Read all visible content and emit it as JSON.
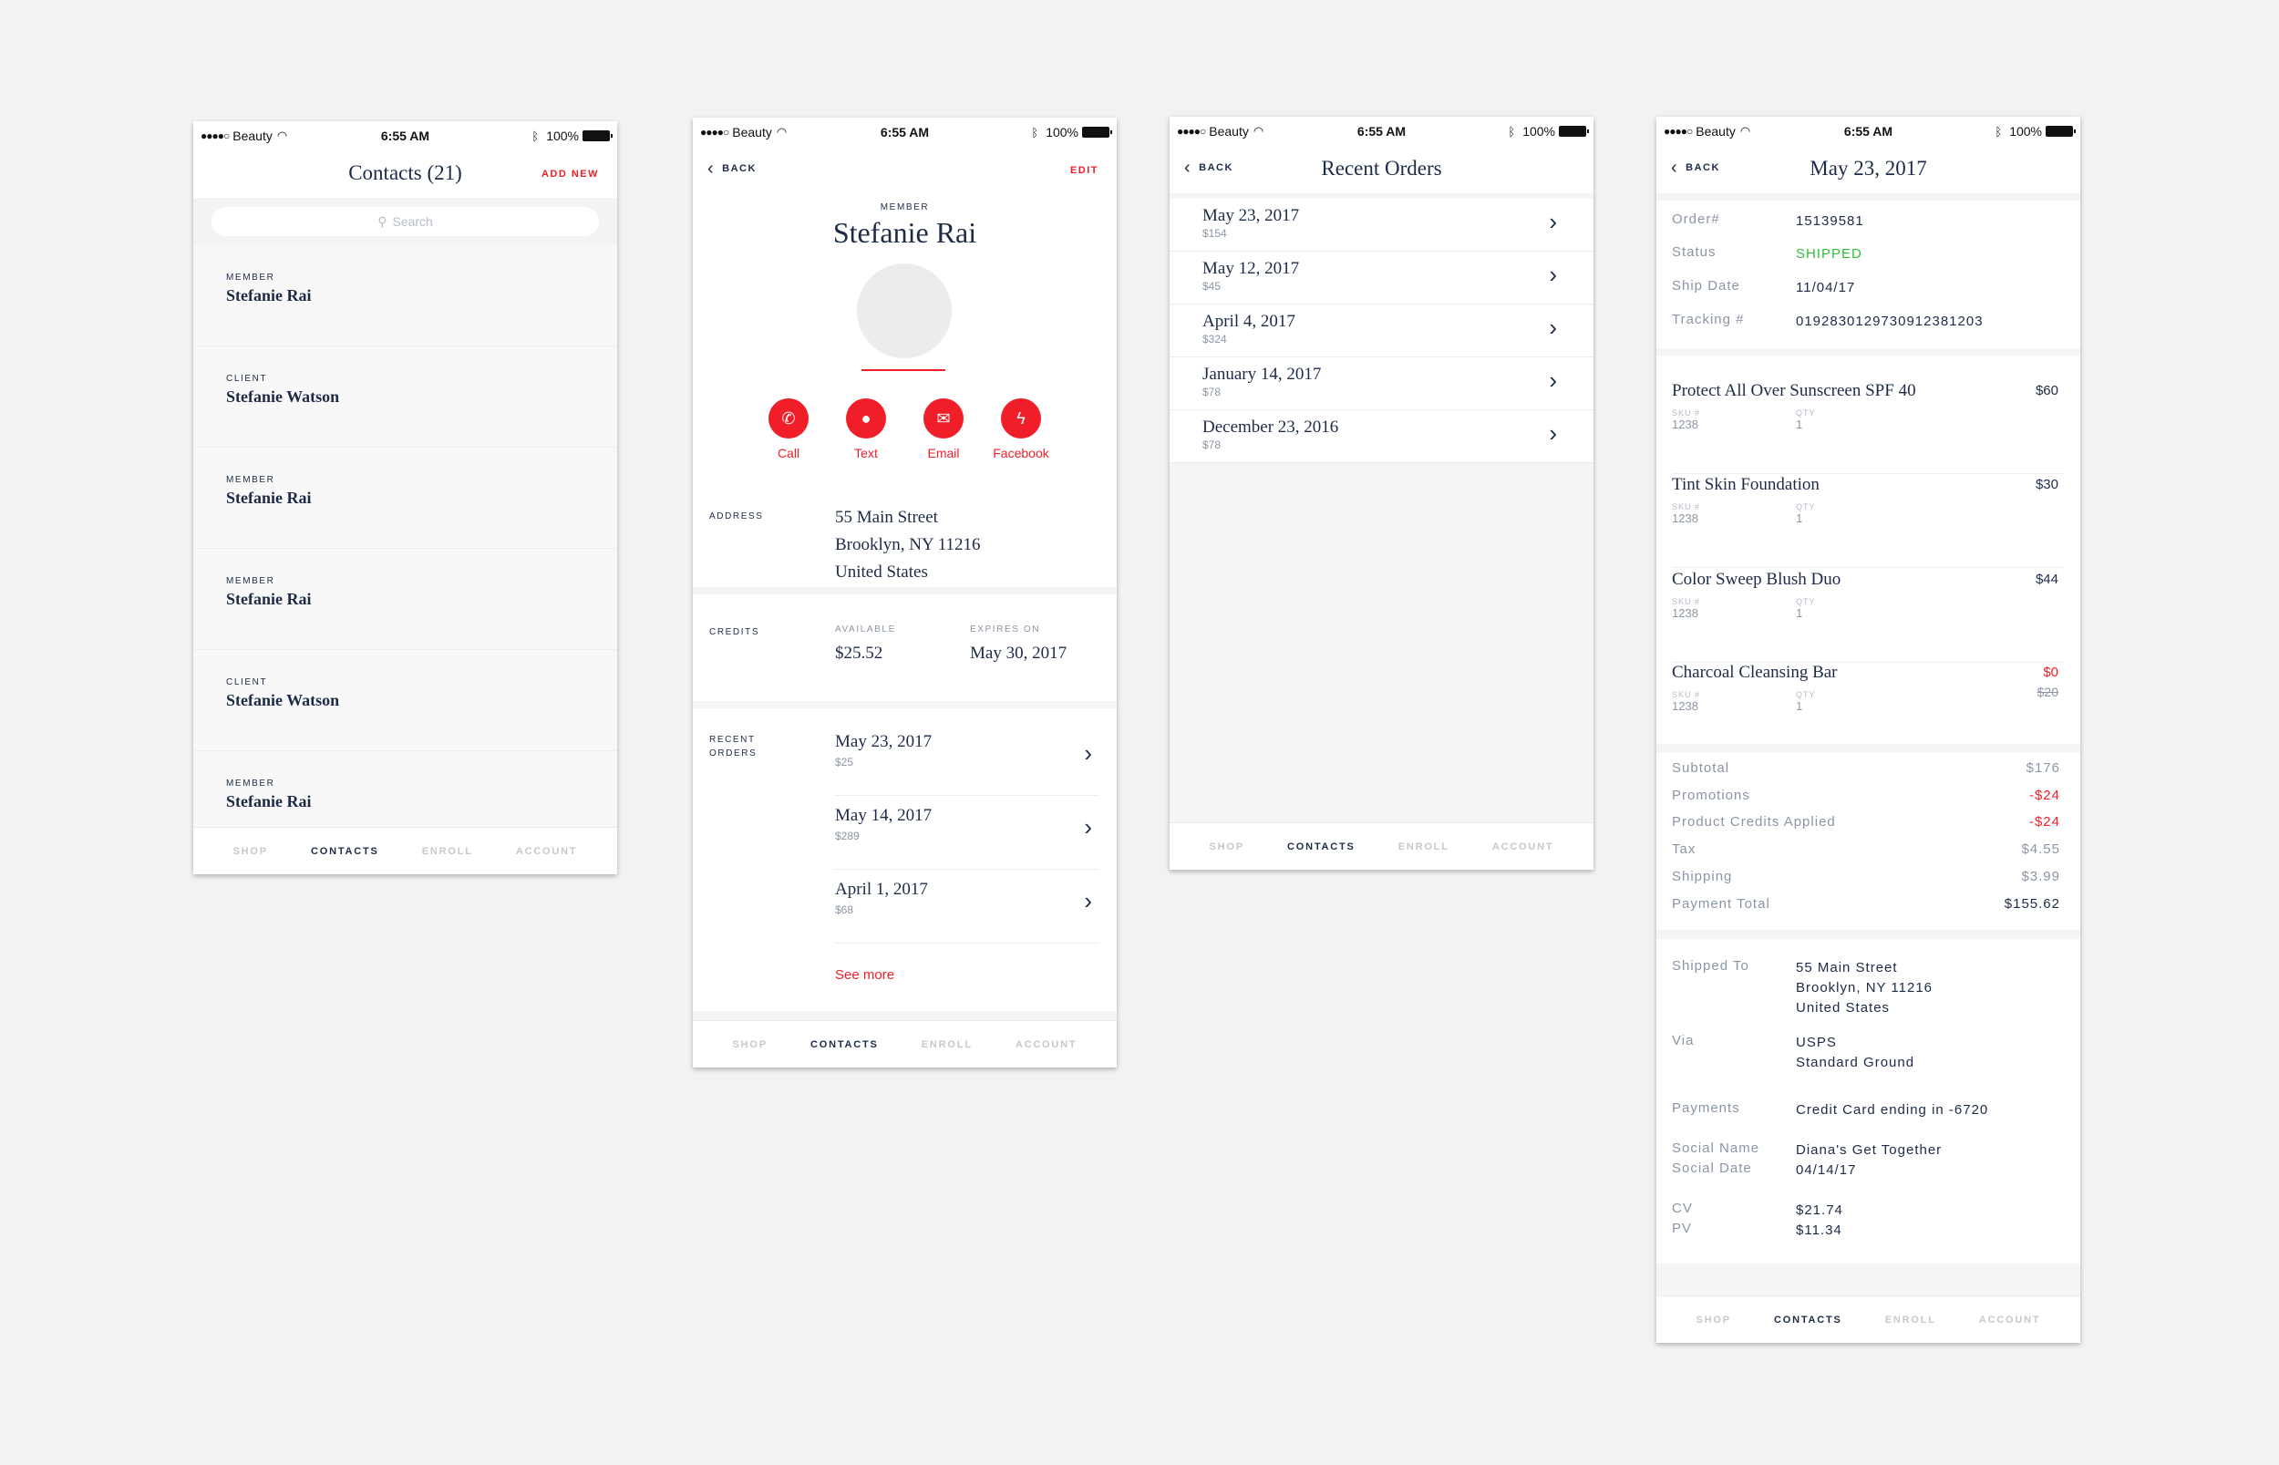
{
  "status_bar": {
    "dots": "●●●●○",
    "carrier": "Beauty",
    "time": "6:55 AM",
    "battery": "100%"
  },
  "tabs": [
    "SHOP",
    "CONTACTS",
    "ENROLL",
    "ACCOUNT"
  ],
  "contacts_screen": {
    "title": "Contacts (21)",
    "action": "ADD NEW",
    "search_placeholder": "Search",
    "contacts": [
      {
        "role": "MEMBER",
        "name": "Stefanie Rai"
      },
      {
        "role": "CLIENT",
        "name": "Stefanie Watson"
      },
      {
        "role": "MEMBER",
        "name": "Stefanie Rai"
      },
      {
        "role": "MEMBER",
        "name": "Stefanie Rai"
      },
      {
        "role": "CLIENT",
        "name": "Stefanie Watson"
      },
      {
        "role": "MEMBER",
        "name": "Stefanie Rai"
      }
    ]
  },
  "profile_screen": {
    "back": "BACK",
    "action": "EDIT",
    "role": "MEMBER",
    "name": "Stefanie Rai",
    "actions": [
      "Call",
      "Text",
      "Email",
      "Facebook"
    ],
    "address_label": "ADDRESS",
    "address": [
      "55 Main Street",
      "Brooklyn, NY 11216",
      "United States"
    ],
    "credits_label": "CREDITS",
    "available_label": "AVAILABLE",
    "available": "$25.52",
    "expires_label": "EXPIRES ON",
    "expires": "May 30, 2017",
    "recent_label_1": "RECENT",
    "recent_label_2": "ORDERS",
    "orders": [
      {
        "date": "May 23, 2017",
        "price": "$25"
      },
      {
        "date": "May 14, 2017",
        "price": "$289"
      },
      {
        "date": "April 1, 2017",
        "price": "$68"
      }
    ],
    "see_more": "See more"
  },
  "orders_screen": {
    "back": "BACK",
    "title": "Recent Orders",
    "orders": [
      {
        "date": "May 23, 2017",
        "price": "$154"
      },
      {
        "date": "May 12, 2017",
        "price": "$45"
      },
      {
        "date": "April 4, 2017",
        "price": "$324"
      },
      {
        "date": "January 14, 2017",
        "price": "$78"
      },
      {
        "date": "December 23, 2016",
        "price": "$78"
      }
    ]
  },
  "order_detail": {
    "back": "BACK",
    "title": "May 23, 2017",
    "info": [
      {
        "k": "Order#",
        "v": "15139581"
      },
      {
        "k": "Status",
        "v": "SHIPPED"
      },
      {
        "k": "Ship Date",
        "v": "11/04/17"
      },
      {
        "k": "Tracking #",
        "v": "0192830129730912381203"
      }
    ],
    "sku_label": "SKU #",
    "qty_label": "QTY",
    "products": [
      {
        "name": "Protect All Over Sunscreen SPF 40",
        "price": "$60",
        "sku": "1238",
        "qty": "1"
      },
      {
        "name": "Tint Skin Foundation",
        "price": "$30",
        "sku": "1238",
        "qty": "1"
      },
      {
        "name": "Color Sweep Blush Duo",
        "price": "$44",
        "sku": "1238",
        "qty": "1"
      },
      {
        "name": "Charcoal Cleansing Bar",
        "price": "$0",
        "original": "$20",
        "sku": "1238",
        "qty": "1"
      }
    ],
    "summary": [
      {
        "k": "Subtotal",
        "v": "$176"
      },
      {
        "k": "Promotions",
        "v": "-$24"
      },
      {
        "k": "Product Credits Applied",
        "v": "-$24"
      },
      {
        "k": "Tax",
        "v": "$4.55"
      },
      {
        "k": "Shipping",
        "v": "$3.99"
      },
      {
        "k": "Payment Total",
        "v": "$155.62"
      }
    ],
    "shipped_to_label": "Shipped To",
    "shipped_to": [
      "55 Main Street",
      "Brooklyn, NY 11216",
      "United States"
    ],
    "via_label": "Via",
    "via": [
      "USPS",
      "Standard Ground"
    ],
    "payments_label": "Payments",
    "payments": "Credit Card ending in -6720",
    "social_name_label": "Social Name",
    "social_name": "Diana's Get Together",
    "social_date_label": "Social Date",
    "social_date": "04/14/17",
    "cv_label": "CV",
    "cv": "$21.74",
    "pv_label": "PV",
    "pv": "$11.34"
  },
  "colors": {
    "accent": "#f01e28",
    "navy": "#1d2b47",
    "success": "#2fbf3b",
    "muted": "#8b95a5"
  }
}
